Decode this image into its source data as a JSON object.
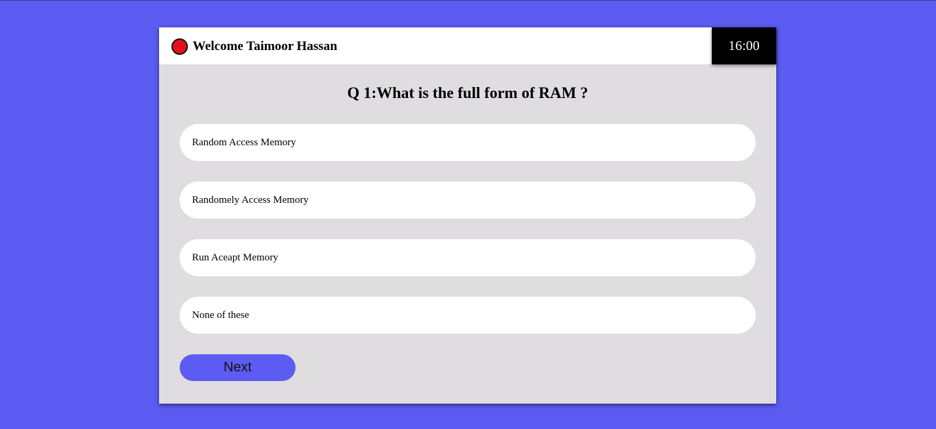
{
  "header": {
    "welcome_text": "Welcome Taimoor Hassan",
    "timer": "16:00"
  },
  "quiz": {
    "question": "Q 1:What is the full form of RAM ?",
    "options": [
      "Random Access Memory",
      "Randomely Access Memory",
      "Run Aceapt Memory",
      "None of these"
    ],
    "next_label": "Next"
  },
  "colors": {
    "background": "#5c5cf2",
    "card": "#dfdddf",
    "status_dot": "#e3101e",
    "timer_bg": "#000000",
    "button": "#5c5cf2"
  }
}
